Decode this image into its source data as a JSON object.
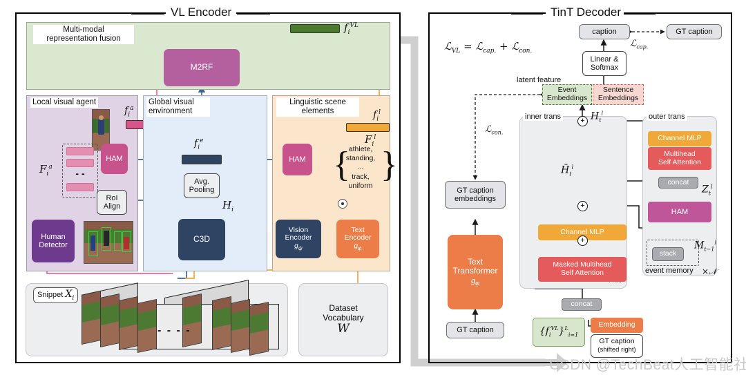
{
  "figure": {
    "watermark": "CSDN @TechBeat人工智能社区"
  },
  "encoder": {
    "title": "VL Encoder",
    "fusion_panel": {
      "label": "Multi-modal\nrepresentation fusion",
      "label_line1": "Multi-modal",
      "label_line2": "representation fusion",
      "m2rf": "M2RF",
      "output_symbol": "f",
      "output_sub": "i",
      "output_sup": "VL"
    },
    "local_visual_agent": {
      "label_line1": "Local visual agent",
      "ham": "HAM",
      "roi_align_line1": "RoI",
      "roi_align_line2": "Align",
      "human_detector_line1": "Human",
      "human_detector_line2": "Detector",
      "feature_symbol": "F",
      "feature_sub": "i",
      "feature_sup": "a",
      "agent_feature_symbol": "f",
      "agent_feature_sub": "i",
      "agent_feature_sup": "a",
      "ellipsis": "- -"
    },
    "global_visual_environment": {
      "label_line1": "Global visual",
      "label_line2": "environment",
      "avg_pool_line1": "Avg.",
      "avg_pool_line2": "Pooling",
      "c3d": "C3D",
      "env_feature_symbol": "f",
      "env_feature_sub": "i",
      "env_feature_sup": "e",
      "hidden_symbol": "H",
      "hidden_sub": "i"
    },
    "linguistic_scene_elements": {
      "label_line1": "Linguistic scene",
      "label_line2": "elements",
      "ham": "HAM",
      "vision_encoder_line1": "Vision",
      "vision_encoder_line2": "Encoder",
      "vision_encoder_sym": "g",
      "vision_encoder_sub": "ψ",
      "text_encoder_line1": "Text",
      "text_encoder_line2": "Encoder",
      "text_encoder_sym": "g",
      "text_encoder_sub": "φ",
      "words": [
        "athlete,",
        "standing,",
        "...",
        "track,",
        "uniform"
      ],
      "lang_feature_symbol": "f",
      "lang_feature_sub": "i",
      "lang_feature_sup": "l",
      "lang_set_symbol": "F",
      "lang_set_sub": "i",
      "lang_set_sup": "l"
    },
    "snippet": {
      "label": "Snippet",
      "symbol": "X",
      "sub": "i",
      "ellipsis": "- - - -"
    },
    "dataset_vocabulary": {
      "line1": "Dataset",
      "line2": "Vocabulary",
      "symbol": "W"
    }
  },
  "decoder": {
    "title": "TinT Decoder",
    "loss_equation": "ℒ_VL = ℒ_cap. + ℒ_con.",
    "loss_vl": "ℒ",
    "loss_vl_sub": "VL",
    "loss_cap": "ℒ",
    "loss_cap_sub": "cap.",
    "loss_con": "ℒ",
    "loss_con_sub": "con.",
    "caption": "caption",
    "gt_caption": "GT caption",
    "linear_softmax_line1": "Linear &",
    "linear_softmax_line2": "Softmax",
    "latent_feature_label": "latent feature",
    "event_embeddings_line1": "Event",
    "event_embeddings_line2": "Embeddings",
    "sentence_embeddings_line1": "Sentence",
    "sentence_embeddings_line2": "Embeddings",
    "gt_caption_embeddings_line1": "GT caption",
    "gt_caption_embeddings_line2": "embeddings",
    "text_transformer_line1": "Text",
    "text_transformer_line2": "Transformer",
    "text_transformer_sym": "g",
    "text_transformer_sub": "φ",
    "gt_caption_input": "GT caption",
    "inner_trans": {
      "label": "inner trans",
      "channel_mlp": "Channel MLP",
      "masked_mha_line1": "Masked Multihead",
      "masked_mha_line2": "Self Attention",
      "repeat": "×𝒩",
      "hbar_symbol": "H̄",
      "hbar_sub": "t",
      "hbar_sup": "l"
    },
    "outer_trans": {
      "label": "outer trans",
      "channel_mlp": "Channel MLP",
      "mha_line1": "Multihead",
      "mha_line2": "Self Attention",
      "concat": "concat",
      "ham": "HAM",
      "stack": "stack",
      "event_memory": "event memory",
      "repeat": "×𝒩",
      "z_symbol": "Z",
      "z_sub": "t",
      "z_sup": "l",
      "m_symbol": "M",
      "m_sub": "t−1",
      "m_sup": "l"
    },
    "h_symbol": "H",
    "h_sub": "t",
    "h_sup": "l",
    "concat_bottom": "concat",
    "vl_features": "{f",
    "vl_features_full": "{fᵢ^VL}ᴸ_{i=1}",
    "embedding": "Embedding",
    "gt_caption_shifted_line1": "GT caption",
    "gt_caption_shifted_line2": "(shifted right)",
    "plus": "+"
  },
  "colors": {
    "fusion_panel_bg": "#d9e8cf",
    "local_agent_bg": "#e0d3e6",
    "global_env_bg": "#e3edf9",
    "linguistic_bg": "#fbe6cc",
    "m2rf": "#b4609f",
    "ham": "#c7528c",
    "ham_outer": "#c0569a",
    "navy": "#2e4462",
    "purple": "#6d3a8e",
    "orange": "#ec7d48",
    "amber": "#f0a838",
    "salmon": "#e55b5b",
    "green_bar": "#4a7a2c",
    "pink_bar": "#e48fb0",
    "event_green": "#d7e6cc",
    "sentence_pink": "#f6d7d2",
    "gray_arrow": "#cfcfcf"
  }
}
